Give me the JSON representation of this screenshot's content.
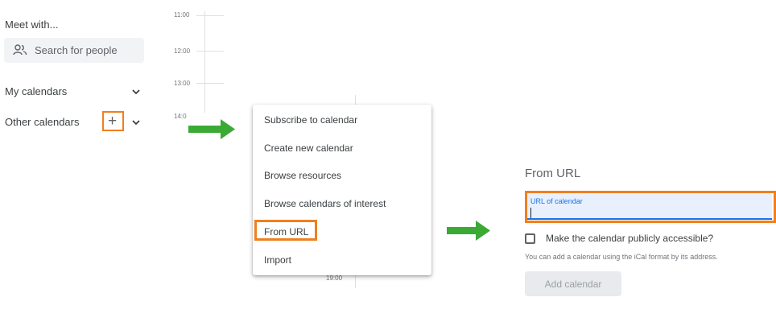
{
  "sidebar": {
    "meet_with": "Meet with...",
    "search_placeholder": "Search for people",
    "my_calendars": "My calendars",
    "other_calendars": "Other calendars",
    "add_icon": "plus-icon"
  },
  "timegrid": {
    "hours": [
      "11:00",
      "12:00",
      "13:00",
      "14:0"
    ],
    "bottom_hour": "19:00"
  },
  "menu": {
    "items": [
      "Subscribe to calendar",
      "Create new calendar",
      "Browse resources",
      "Browse calendars of interest",
      "From URL",
      "Import"
    ],
    "highlighted": "From URL"
  },
  "from_url_panel": {
    "title": "From URL",
    "url_label": "URL of calendar",
    "url_value": "",
    "public_checkbox_label": "Make the calendar publicly accessible?",
    "checkbox_checked": false,
    "hint": "You can add a calendar using the iCal format by its address.",
    "add_button": "Add calendar"
  },
  "colors": {
    "highlight": "#f07f1f",
    "arrow": "#3aaa35",
    "accent": "#1a73e8"
  }
}
